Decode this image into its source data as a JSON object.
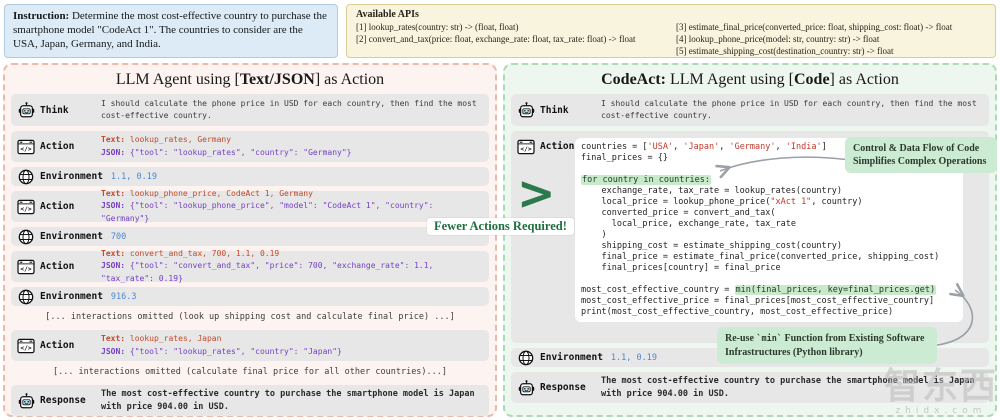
{
  "instruction": {
    "label": "Instruction:",
    "text": " Determine the most cost-effective country to purchase the smartphone model \"CodeAct 1\". The countries to consider are the USA, Japan, Germany, and India."
  },
  "apis": {
    "title": "Available APIs",
    "col1": [
      "[1] lookup_rates(country: str) -> (float, float)",
      "[2] convert_and_tax(price: float, exchange_rate: float, tax_rate: float) -> float"
    ],
    "col2": [
      "[3] estimate_final_price(converted_price: float, shipping_cost: float) -> float",
      "[4] lookup_phone_price(model: str, country: str) -> float",
      "[5] estimate_shipping_cost(destination_country: str) -> float"
    ]
  },
  "left": {
    "title": {
      "pre": "LLM Agent using [",
      "bold": "Text/JSON",
      "post": "] as Action"
    },
    "think": {
      "label": "Think",
      "text": "I should calculate the phone price in USD for each country, then find the most cost-effective country."
    },
    "action1": {
      "label": "Action",
      "text_label": "Text:",
      "text": " lookup_rates, Germany",
      "json_label": "JSON:",
      "json": " {\"tool\": \"lookup_rates\", \"country\": \"Germany\"}"
    },
    "env1": {
      "label": "Environment",
      "value": "1.1, 0.19"
    },
    "action2": {
      "label": "Action",
      "text_label": "Text:",
      "text": " lookup_phone_price, CodeAct 1, Germany",
      "json_label": "JSON:",
      "json": " {\"tool\": \"lookup_phone_price\", \"model\": \"CodeAct 1\", \"country\": \"Germany\"}"
    },
    "env2": {
      "label": "Environment",
      "value": "700"
    },
    "action3": {
      "label": "Action",
      "text_label": "Text:",
      "text": " convert_and_tax, 700, 1.1, 0.19",
      "json_label": "JSON:",
      "json": " {\"tool\": \"convert_and_tax\", \"price\": 700, \"exchange_rate\": 1.1, \"tax_rate\": 0.19}"
    },
    "env3": {
      "label": "Environment",
      "value": "916.3"
    },
    "omitted1": "[... interactions omitted (look up shipping cost and calculate final price) ...]",
    "action4": {
      "label": "Action",
      "text_label": "Text:",
      "text": " lookup_rates, Japan",
      "json_label": "JSON:",
      "json": " {\"tool\": \"lookup_rates\", \"country\": \"Japan\"}"
    },
    "omitted2": "[... interactions omitted (calculate final price for all other countries)...]",
    "response": {
      "label": "Response",
      "text": "The most cost-effective country to purchase the smartphone model is Japan with price 904.00 in USD."
    }
  },
  "right": {
    "title": {
      "bold1": "CodeAct:",
      "mid": " LLM Agent using [",
      "bold2": "Code",
      "post": "] as Action"
    },
    "think": {
      "label": "Think",
      "text": "I should calculate the phone price in USD for each country, then find the most cost-effective country."
    },
    "action_label": "Action",
    "gt_symbol": ">",
    "fewer_actions": "Fewer Actions Required!",
    "annotation1": "Control & Data Flow of Code Simplifies Complex Operations",
    "annotation2": {
      "pre": "Re-use ",
      "code": "`min`",
      "post": " Function from Existing Software Infrastructures (Python library)"
    },
    "env": {
      "label": "Environment",
      "value": "1.1, 0.19"
    },
    "response": {
      "label": "Response",
      "text": "The most cost-effective country to purchase the smartphone model is Japan with price 904.00 in USD."
    },
    "code_lines": [
      [
        {
          "t": "countries = [",
          "c": "p"
        },
        {
          "t": "'USA'",
          "c": "s"
        },
        {
          "t": ", ",
          "c": "p"
        },
        {
          "t": "'Japan'",
          "c": "s"
        },
        {
          "t": ", ",
          "c": "p"
        },
        {
          "t": "'Germany'",
          "c": "s"
        },
        {
          "t": ", ",
          "c": "p"
        },
        {
          "t": "'India'",
          "c": "s"
        },
        {
          "t": "]",
          "c": "p"
        }
      ],
      [
        {
          "t": "final_prices = {}",
          "c": "p"
        }
      ],
      [
        {
          "t": "",
          "c": "p"
        }
      ],
      [
        {
          "t": "for country in countries:",
          "c": "hl"
        }
      ],
      [
        {
          "t": "    exchange_rate, tax_rate = lookup_rates(country)",
          "c": "p"
        }
      ],
      [
        {
          "t": "    local_price = lookup_phone_price(",
          "c": "p"
        },
        {
          "t": "\"xAct 1\"",
          "c": "s"
        },
        {
          "t": ", country)",
          "c": "p"
        }
      ],
      [
        {
          "t": "    converted_price = convert_and_tax(",
          "c": "p"
        }
      ],
      [
        {
          "t": "      local_price, exchange_rate, tax_rate",
          "c": "p"
        }
      ],
      [
        {
          "t": "    )",
          "c": "p"
        }
      ],
      [
        {
          "t": "    shipping_cost = estimate_shipping_cost(country)",
          "c": "p"
        }
      ],
      [
        {
          "t": "    final_price = estimate_final_price(converted_price, shipping_cost)",
          "c": "p"
        }
      ],
      [
        {
          "t": "    final_prices[country] = final_price",
          "c": "p"
        }
      ],
      [
        {
          "t": "",
          "c": "p"
        }
      ],
      [
        {
          "t": "most_cost_effective_country = ",
          "c": "p"
        },
        {
          "t": "min(final_prices, key=final_prices.get)",
          "c": "hl"
        }
      ],
      [
        {
          "t": "most_cost_effective_price = final_prices[most_cost_effective_country]",
          "c": "p"
        }
      ],
      [
        {
          "t": "print(most_cost_effective_country, most_cost_effective_price)",
          "c": "p"
        }
      ]
    ]
  },
  "watermark": {
    "text": "智东西",
    "sub": "zhidx.com"
  },
  "colors": {
    "left_panel_bg": "#fdf3f0",
    "left_panel_border": "#ecb9ab",
    "right_panel_bg": "#eef7ef",
    "right_panel_border": "#aed9b5",
    "row_bg": "#e7e7e7",
    "text_action": "#c24a2d",
    "json_action": "#7540c6",
    "env_value": "#4a87d9",
    "code_string": "#c0392b",
    "code_highlight_bg": "#c9e9cb",
    "annotation_bg": "#cbebd3",
    "accent_green": "#2b7a4b"
  }
}
